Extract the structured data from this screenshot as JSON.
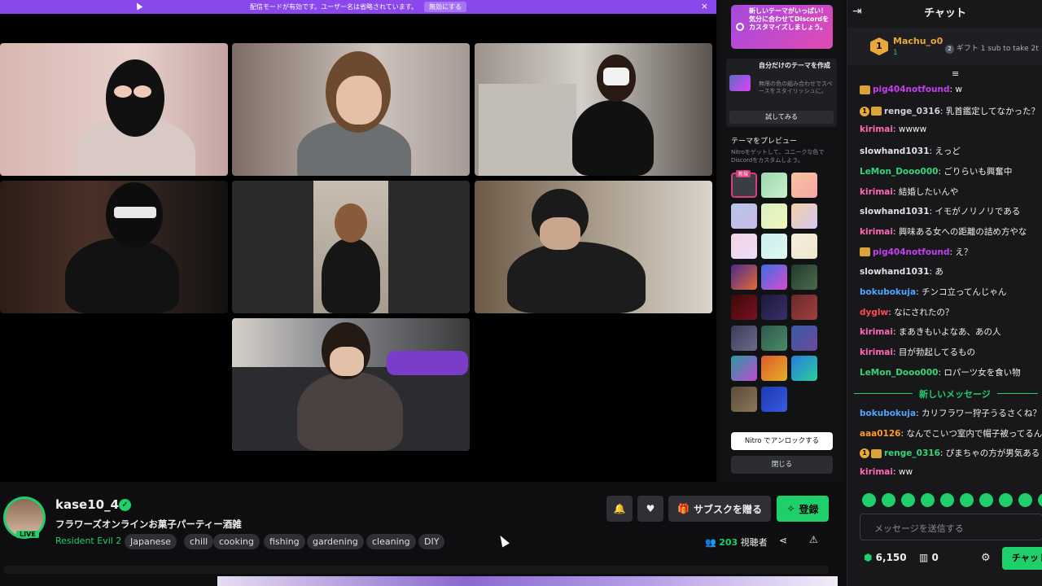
{
  "banner": {
    "text": "配信モードが有効です。ユーザー名は省略されています。",
    "button": "無効にする",
    "close": "×"
  },
  "discord": {
    "promo": "新しいテーマがいっぱい！気分に合わせてDiscordをカスタマイズしましょう。",
    "own_theme_title": "自分だけのテーマを作成",
    "own_theme_desc": "無限の色の組み合わせでスペースをスタイリッシュに。",
    "try_button": "試してみる",
    "preview_title": "テーマをプレビュー",
    "preview_desc": "Nitroをゲットして、ユニークな色でDiscordをカスタムしよう。",
    "new_badge": "新規",
    "unlock_button": "Nitro でアンロックする",
    "close_button": "閉じる"
  },
  "streamer": {
    "name": "kase10_4",
    "title": "フラワーズオンラインお菓子パーティー酒雑",
    "live": "LIVE",
    "game": "Resident Evil 2",
    "tags": [
      "Japanese",
      "chill",
      "cooking",
      "fishing",
      "gardening",
      "cleaning",
      "DIY"
    ],
    "viewers": "203",
    "viewers_label": "視聴者"
  },
  "actions": {
    "gift_sub": "サブスクを贈る",
    "subscribe": "登録"
  },
  "chat": {
    "title": "チャット",
    "gift_user": "Machu_o0",
    "gift_rank": "1",
    "gift_count": "1",
    "gift_text": "ギフト 1 sub to take 2t",
    "messages": [
      {
        "user": "pig404notfound",
        "color": "#c53ef2",
        "text": ": w",
        "badges": "s"
      },
      {
        "user": "renge_0316",
        "color": "#cfcfd6",
        "text": ": 乳首鑑定してなかった？",
        "badges": "1s"
      },
      {
        "user": "kirimai",
        "color": "#ff69b4",
        "text": ": wwww",
        "badges": ""
      },
      {
        "user": "slowhand1031",
        "color": "#e0e0e6",
        "text": ": えっど",
        "badges": ""
      },
      {
        "user": "LeMon_Dooo000",
        "color": "#39d47a",
        "text": ": ごりらいも興奮中",
        "badges": ""
      },
      {
        "user": "kirimai",
        "color": "#ff69b4",
        "text": ": 結婚したいんや",
        "badges": ""
      },
      {
        "user": "slowhand1031",
        "color": "#e0e0e6",
        "text": ": イモがノリノリである",
        "badges": ""
      },
      {
        "user": "kirimai",
        "color": "#ff69b4",
        "text": ": 興味ある女への距離の詰め方やな",
        "badges": ""
      },
      {
        "user": "pig404notfound",
        "color": "#c53ef2",
        "text": ": え？",
        "badges": "s"
      },
      {
        "user": "slowhand1031",
        "color": "#e0e0e6",
        "text": ": あ",
        "badges": ""
      },
      {
        "user": "bokubokuja",
        "color": "#4fa5ff",
        "text": ": チンコ立ってんじゃん",
        "badges": ""
      },
      {
        "user": "dyglw",
        "color": "#ff4b4b",
        "text": ": なにされたの？",
        "badges": ""
      },
      {
        "user": "kirimai",
        "color": "#ff69b4",
        "text": ": まあきもいよなあ、あの人",
        "badges": ""
      },
      {
        "user": "kirimai",
        "color": "#ff69b4",
        "text": ": 目が勃起してるもの",
        "badges": ""
      },
      {
        "user": "LeMon_Dooo000",
        "color": "#39d47a",
        "text": ": ロパーツ女を食い物",
        "badges": ""
      }
    ],
    "new_messages": "新しいメッセージ",
    "messages2": [
      {
        "user": "bokubokuja",
        "color": "#4fa5ff",
        "text": ": カリフラワー狩子うるさくね？",
        "badges": ""
      },
      {
        "user": "aaa0126",
        "color": "#ff9a2e",
        "text": ": なんでこいつ室内で帽子被ってるんだ",
        "badges": ""
      },
      {
        "user": "renge_0316",
        "color": "#39d47a",
        "text": ": ぴまちゃの方が男気ある",
        "badges": "1s"
      },
      {
        "user": "kirimai",
        "color": "#ff69b4",
        "text": ": ww",
        "badges": ""
      }
    ],
    "input_placeholder": "メッセージを送信する",
    "points": "6,150",
    "drops": "0",
    "chat_button": "チャット"
  },
  "colors": {
    "accent": "#9147ff",
    "green": "#00f593",
    "banner": "#8a47ec"
  }
}
